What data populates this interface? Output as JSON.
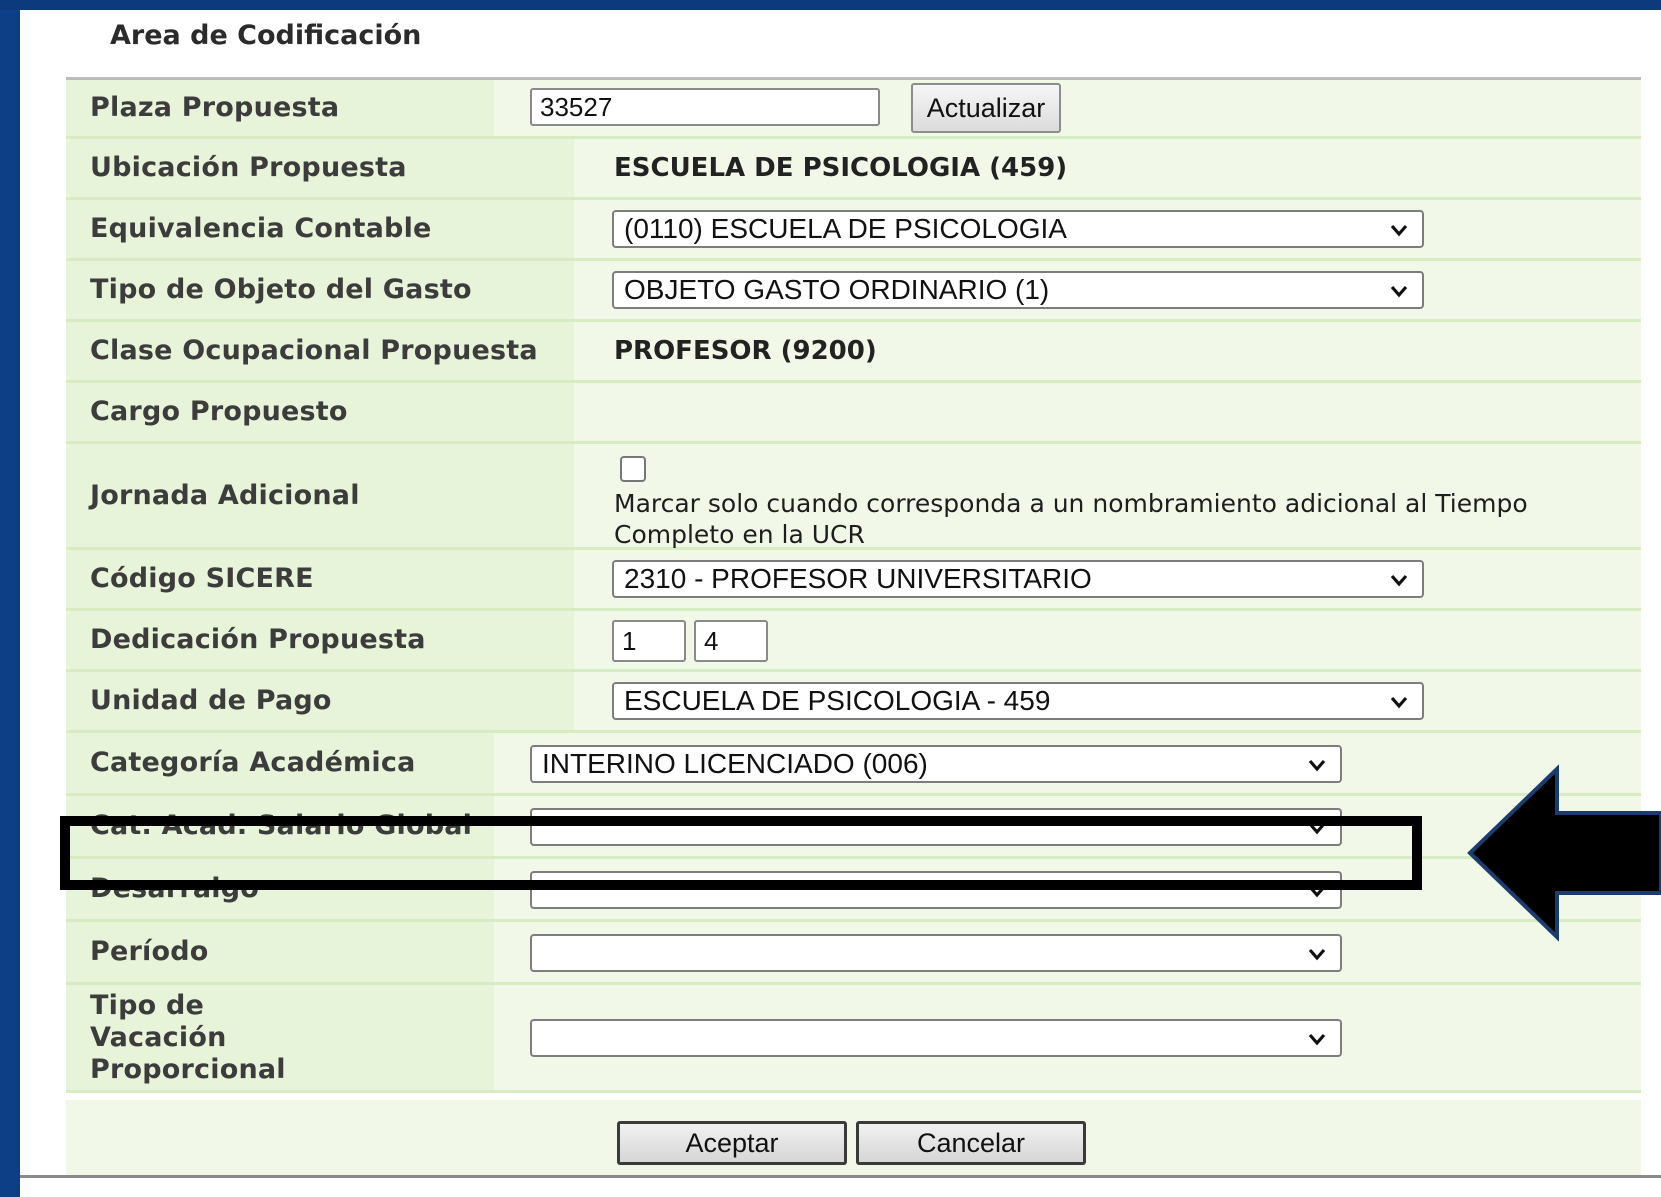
{
  "section_title": "Area de Codificación",
  "rows": {
    "plaza": {
      "label": "Plaza Propuesta",
      "value": "33527",
      "button": "Actualizar"
    },
    "ubicacion": {
      "label": "Ubicación Propuesta",
      "value": "ESCUELA DE PSICOLOGIA (459)"
    },
    "equivalencia": {
      "label": "Equivalencia Contable",
      "selected": "(0110) ESCUELA DE PSICOLOGIA"
    },
    "tipo_objeto": {
      "label": "Tipo de Objeto del Gasto",
      "selected": "OBJETO GASTO ORDINARIO (1)"
    },
    "clase": {
      "label": "Clase Ocupacional Propuesta",
      "value": "PROFESOR (9200)"
    },
    "cargo": {
      "label": "Cargo Propuesto",
      "value": ""
    },
    "jornada": {
      "label": "Jornada Adicional",
      "checked": false,
      "note": "Marcar solo cuando corresponda a un nombramiento adicional al Tiempo Completo en la UCR"
    },
    "sicere": {
      "label": "Código SICERE",
      "selected": "2310 - PROFESOR UNIVERSITARIO"
    },
    "dedicacion": {
      "label": "Dedicación Propuesta",
      "value1": "1",
      "value2": "4"
    },
    "unidad_pago": {
      "label": "Unidad de Pago",
      "selected": "ESCUELA DE PSICOLOGIA - 459"
    },
    "categoria": {
      "label": "Categoría Académica",
      "selected": "INTERINO LICENCIADO (006)"
    },
    "cat_salario": {
      "label": "Cat. Acad. Salario Global",
      "selected": ""
    },
    "desarraigo": {
      "label": "Desarraigo",
      "selected": ""
    },
    "periodo": {
      "label": "Período",
      "selected": ""
    },
    "vacacion": {
      "label": "Tipo de Vacación Proporcional",
      "selected": ""
    }
  },
  "buttons": {
    "accept": "Aceptar",
    "cancel": "Cancelar"
  },
  "colors": {
    "row_bg": "#f2f8e8",
    "label_bg": "#e8f4d9",
    "frame": "#0d3f86"
  }
}
